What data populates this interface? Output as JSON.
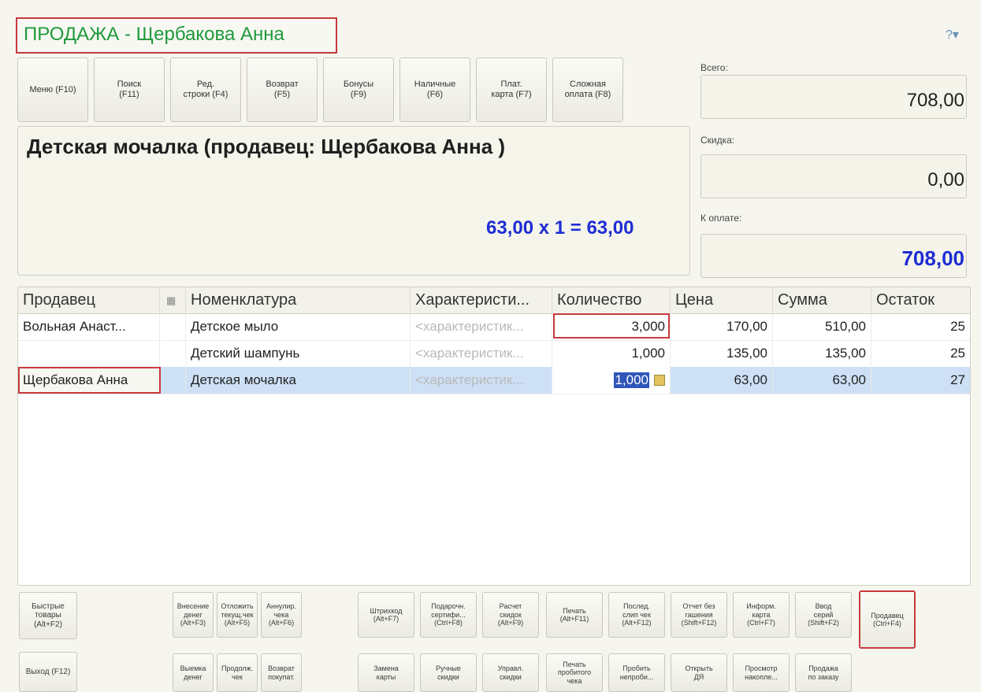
{
  "title": "ПРОДАЖА - Щербакова Анна",
  "top_buttons": [
    {
      "label": "Меню (F10)"
    },
    {
      "label": "Поиск\n(F11)"
    },
    {
      "label": "Ред.\nстроки (F4)"
    },
    {
      "label": "Возврат\n(F5)"
    },
    {
      "label": "Бонусы\n(F9)"
    },
    {
      "label": "Наличные\n(F6)"
    },
    {
      "label": "Плат.\nкарта (F7)"
    },
    {
      "label": "Сложная\nоплата (F8)"
    }
  ],
  "current": {
    "product": "Детская мочалка (продавец: Щербакова Анна )",
    "calc": "63,00  х 1  = 63,00"
  },
  "totals": {
    "total_label": "Всего:",
    "total_value": "708,00",
    "discount_label": "Скидка:",
    "discount_value": "0,00",
    "pay_label": "К оплате:",
    "pay_value": "708,00",
    "pay_color": "#1e2dd3"
  },
  "table": {
    "headers": [
      "Продавец",
      "Номенклатура",
      "Характеристи...",
      "Количество",
      "Цена",
      "Сумма",
      "Остаток"
    ],
    "rows": [
      {
        "seller": "Вольная Анаст...",
        "item": "Детское мыло",
        "char": "<характеристик...",
        "qty": "3,000",
        "price": "170,00",
        "sum": "510,00",
        "rest": "25"
      },
      {
        "seller": "",
        "item": "Детский шампунь",
        "char": "<характеристик...",
        "qty": "1,000",
        "price": "135,00",
        "sum": "135,00",
        "rest": "25"
      },
      {
        "seller": "Щербакова Анна",
        "item": "Детская мочалка",
        "char": "<характеристик...",
        "qty": "1,000",
        "price": "63,00",
        "sum": "63,00",
        "rest": "27"
      }
    ],
    "selected_color": "#cde0f5"
  },
  "bottom_row1": [
    {
      "label": "Быстрые\nтовары\n(Alt+F2)"
    },
    {
      "label": "Внесение\nденег\n(Alt+F3)"
    },
    {
      "label": "Отложить\nтекущ.чек\n(Alt+F5)"
    },
    {
      "label": "Аннулир.\nчека\n(Alt+F6)"
    },
    {
      "label": "Штрихкод\n(Alt+F7)"
    },
    {
      "label": "Подарочн.\nсертифи...\n(Ctrl+F8)"
    },
    {
      "label": "Расчет\nскидок\n(Alt+F9)"
    },
    {
      "label": "Печать\n(Alt+F11)"
    },
    {
      "label": "Послед.\nслип чек\n(Alt+F12)"
    },
    {
      "label": "Отчет без\nгашения\n(Shift+F12)"
    },
    {
      "label": "Информ.\nкарта\n(Ctrl+F7)"
    },
    {
      "label": "Ввод\nсерий\n(Shift+F2)"
    },
    {
      "label": "Продавец\n(Ctrl+F4)"
    }
  ],
  "bottom_row2": [
    {
      "label": "Выход (F12)"
    },
    {
      "label": "Выемка\nденег"
    },
    {
      "label": "Продолж.\nчек"
    },
    {
      "label": "Возврат\nпокупат."
    },
    {
      "label": "Замена\nкарты"
    },
    {
      "label": "Ручные\nскидки"
    },
    {
      "label": "Управл.\nскидки"
    },
    {
      "label": "Печать\nпробитого\nчека"
    },
    {
      "label": "Пробить\nнепроби..."
    },
    {
      "label": "Открыть\nДЯ"
    },
    {
      "label": "Просмотр\nнакопле..."
    },
    {
      "label": "Продажа\nпо заказу"
    }
  ]
}
